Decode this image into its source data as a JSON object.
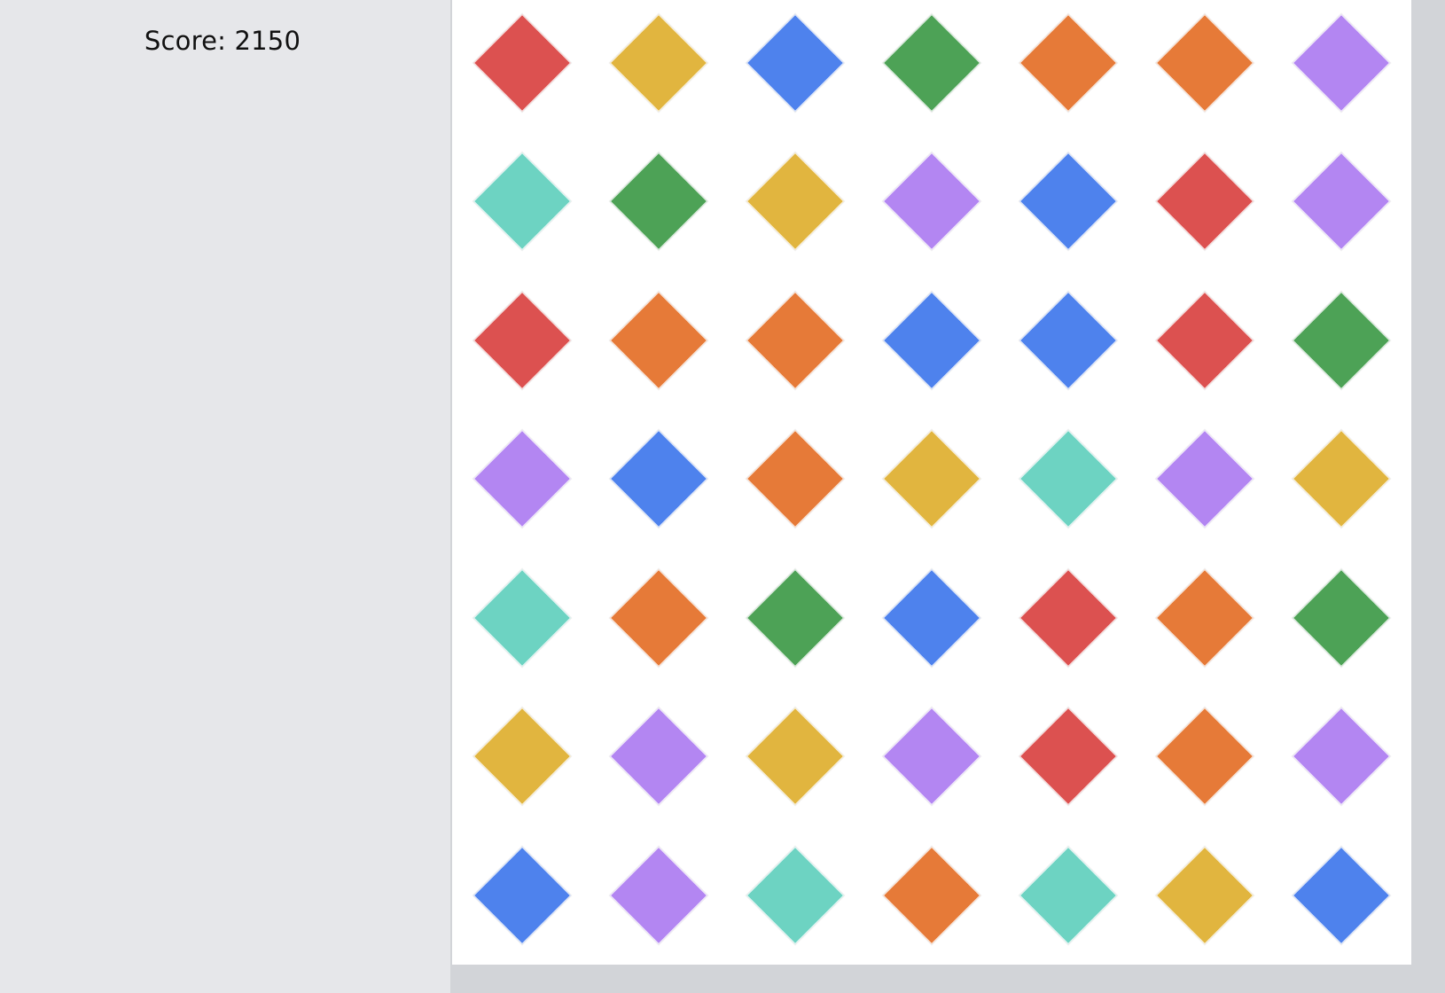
{
  "score": {
    "text": "Score: 2150"
  },
  "colors": {
    "red": "#dc5150",
    "yellow": "#e1b53f",
    "blue": "#4e82ed",
    "green": "#4da256",
    "orange": "#e67a38",
    "purple": "#b386f2",
    "teal": "#6dd3c2"
  },
  "board": {
    "rows": [
      [
        "red",
        "yellow",
        "blue",
        "green",
        "orange",
        "orange",
        "purple"
      ],
      [
        "teal",
        "green",
        "yellow",
        "purple",
        "blue",
        "red",
        "purple"
      ],
      [
        "red",
        "orange",
        "orange",
        "blue",
        "blue",
        "red",
        "green"
      ],
      [
        "purple",
        "blue",
        "orange",
        "yellow",
        "teal",
        "purple",
        "yellow"
      ],
      [
        "teal",
        "orange",
        "green",
        "blue",
        "red",
        "orange",
        "green"
      ],
      [
        "yellow",
        "purple",
        "yellow",
        "purple",
        "red",
        "orange",
        "purple"
      ],
      [
        "blue",
        "purple",
        "teal",
        "orange",
        "teal",
        "yellow",
        "blue"
      ]
    ]
  }
}
